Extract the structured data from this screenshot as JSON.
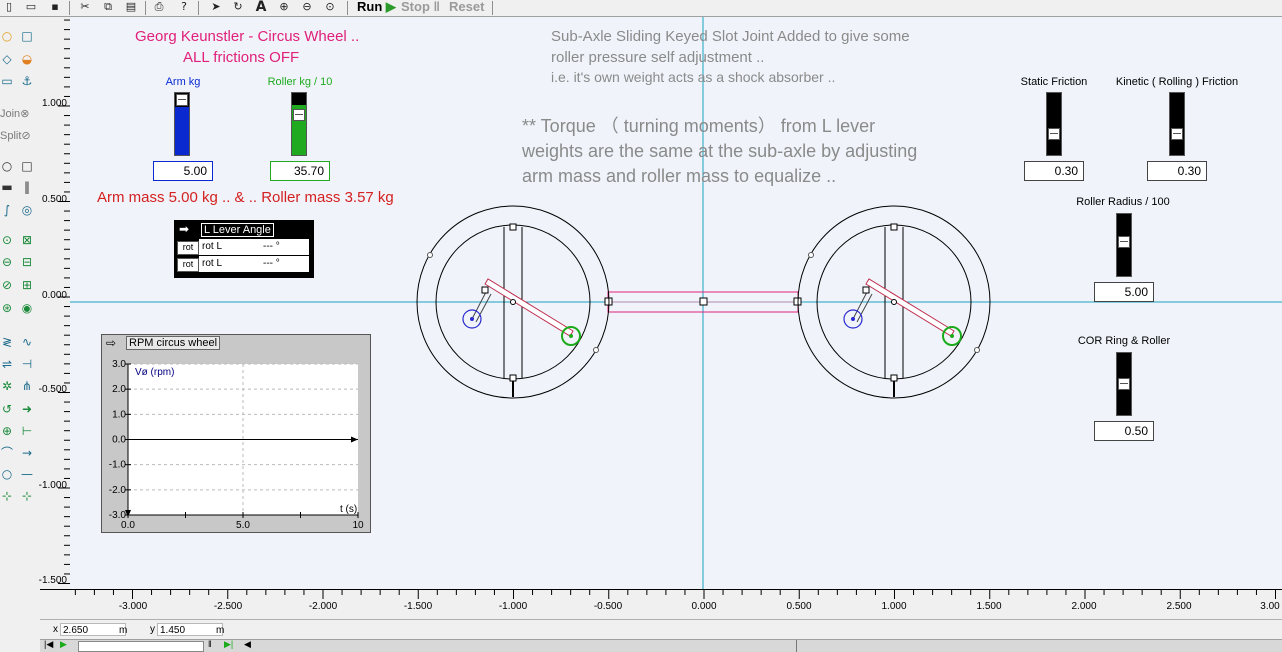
{
  "toolbar": {
    "icons": [
      "new-file-icon",
      "open-folder-icon",
      "save-icon",
      "cut-icon",
      "copy-icon",
      "paste-icon",
      "print-icon",
      "help-icon",
      "pointer-icon",
      "rotate-icon",
      "text-icon",
      "zoom-in-icon",
      "zoom-out-icon",
      "zoom-fit-icon"
    ],
    "run_label": "Run",
    "stop_label": "Stop",
    "reset_label": "Reset",
    "run_color": "#2a9a2a"
  },
  "palette": {
    "join_label": "Join",
    "split_label": "Split"
  },
  "ruler": {
    "y_ticks": [
      "1.000",
      "0.500",
      "0.000",
      "-0.500",
      "-1.000",
      "-1.500"
    ],
    "x_ticks": [
      "-3.000",
      "-2.500",
      "-2.000",
      "-1.500",
      "-1.000",
      "-0.500",
      "0.000",
      "0.500",
      "1.000",
      "1.500",
      "2.000",
      "2.500",
      "3.00"
    ]
  },
  "canvas": {
    "title_line1": "Georg Keunstler - Circus Wheel ..",
    "title_line2": "ALL frictions OFF",
    "note_line1": "Sub-Axle Sliding Keyed Slot Joint Added to give some",
    "note_line2": "roller pressure self adjustment ..",
    "note_line3": "i.e. it's own weight acts as a shock absorber ..",
    "torque_line1": "** Torque （ turning moments） from L lever",
    "torque_line2": "weights are the same at the sub-axle by adjusting",
    "torque_line3": "arm mass and roller mass to equalize ..",
    "mass_text": "Arm mass 5.00 kg .. & .. Roller mass 3.57 kg",
    "title_color": "#e0207a",
    "mass_color": "#d42020"
  },
  "sliders": {
    "arm": {
      "label": "Arm kg",
      "value": "5.00",
      "color": "#0a2ad0",
      "fill": 0.8
    },
    "roller": {
      "label": "Roller kg / 10",
      "value": "35.70",
      "color": "#1faa1f",
      "fill": 0.57
    },
    "static_friction": {
      "label": "Static Friction",
      "value": "0.30"
    },
    "kinetic_friction": {
      "label": "Kinetic ( Rolling ) Friction",
      "value": "0.30"
    },
    "roller_radius": {
      "label": "Roller Radius / 100",
      "value": "5.00"
    },
    "cor": {
      "label": "COR Ring & Roller",
      "value": "0.50"
    }
  },
  "meter": {
    "title": "L Lever Angle",
    "rows": [
      {
        "button": "rot",
        "label": "rot L",
        "value": "--- °"
      },
      {
        "button": "rot",
        "label": "rot L",
        "value": "--- °"
      }
    ]
  },
  "graph": {
    "title": "RPM circus wheel",
    "ylabel": "Vø (rpm)",
    "xlabel": "t (s)",
    "y_ticks": [
      "3.0",
      "2.0",
      "1.0",
      "0.0",
      "-1.0",
      "-2.0",
      "-3.0"
    ],
    "x_ticks": [
      "0.0",
      "5.0",
      "10"
    ]
  },
  "chart_data": {
    "type": "line",
    "title": "RPM circus wheel",
    "xlabel": "t (s)",
    "ylabel": "Vø (rpm)",
    "xlim": [
      0,
      10
    ],
    "ylim": [
      -3,
      3
    ],
    "grid": true,
    "series": []
  },
  "status": {
    "x_label": "x",
    "x_value": "2.650",
    "x_unit": "m",
    "y_label": "y",
    "y_value": "1.450",
    "y_unit": "m"
  }
}
